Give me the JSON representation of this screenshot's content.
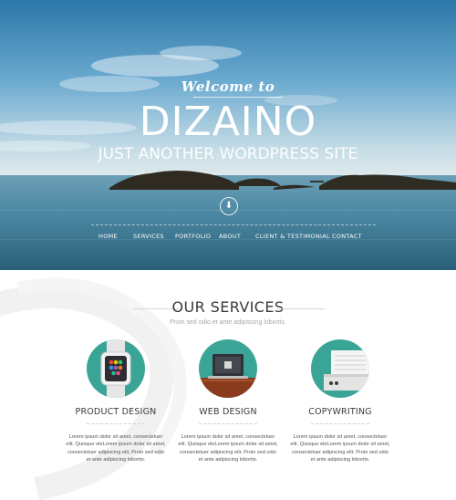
{
  "hero": {
    "welcome": "Welcome to",
    "brand": "DIZAINO",
    "tagline": "JUST ANOTHER WORDPRESS SITE",
    "scroll_glyph": "⬇"
  },
  "nav": {
    "items": [
      "HOME",
      "SERVICES",
      "PORTFOLIO",
      "ABOUT",
      "CLIENT & TESTIMONIAL",
      "CONTACT"
    ]
  },
  "services": {
    "title": "OUR SERVICES",
    "subtitle": "Proin sed odio et ante adipiscing lobortis.",
    "cards": [
      {
        "title": "PRODUCT DESIGN",
        "icon": "smartwatch-icon",
        "text": "Lorem ipsum dolor sit amet, consectetuer elit. Quisque eleLorem ipsum dolor sit amet, consectetuer adipiscing elit. Proin sed odio et ante adipiscing lobortis."
      },
      {
        "title": "WEB DESIGN",
        "icon": "laptop-icon",
        "text": "Lorem ipsum dolor sit amet, consectetuer elit. Quisque eleLorem ipsum dolor sit amet, consectetuer adipiscing elit. Proin sed odio et ante adipiscing lobortis."
      },
      {
        "title": "COPYWRITING",
        "icon": "typewriter-icon",
        "text": "Lorem ipsum dolor sit amet, consectetuer elit. Quisque eleLorem ipsum dolor sit amet, consectetuer adipiscing elit. Proin sed odio et ante adipiscing lobortis."
      }
    ]
  },
  "colors": {
    "accent": "#3aa596",
    "text_dark": "#3a3a3a",
    "text_muted": "#a7a7a7"
  }
}
